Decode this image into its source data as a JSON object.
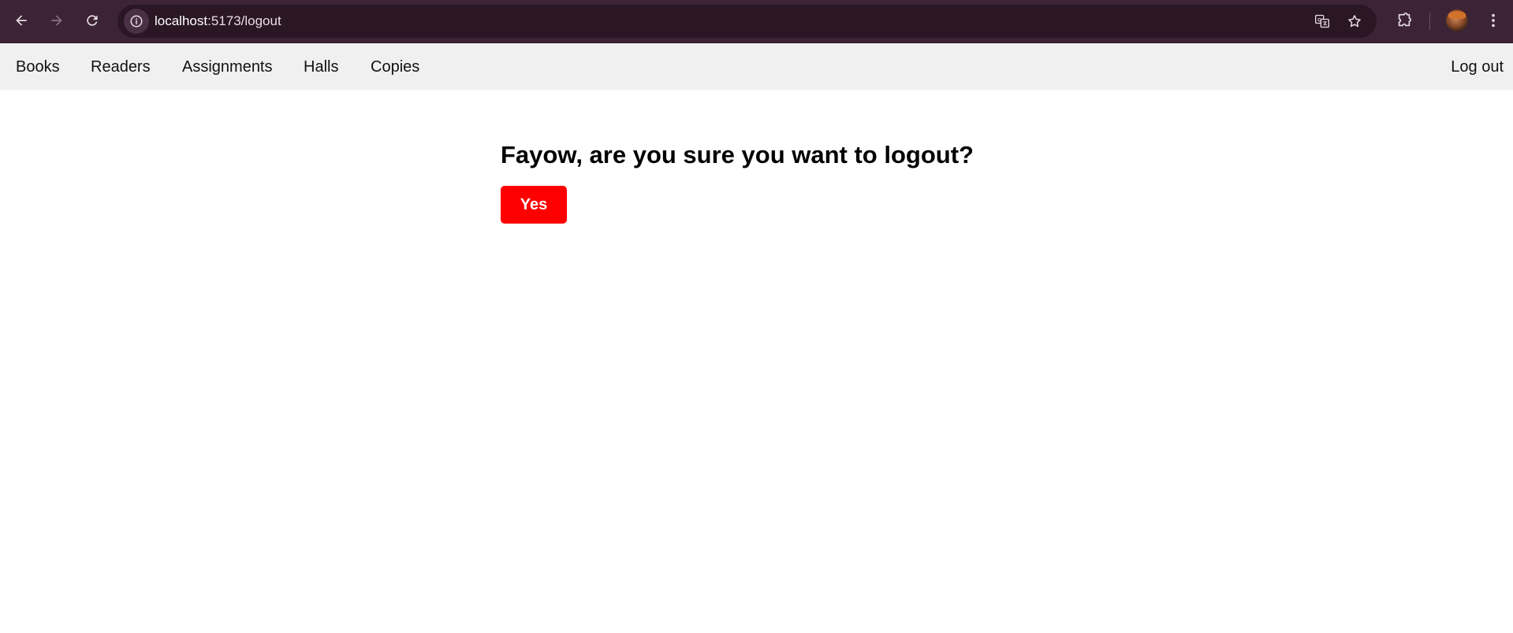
{
  "browser": {
    "url_host": "localhost",
    "url_path": ":5173/logout",
    "frame_color": "#3c2335",
    "omnibox_color": "#2a1624",
    "icons": {
      "back": "arrow-left-icon",
      "forward": "arrow-right-icon",
      "reload": "reload-icon",
      "site_info": "info-icon",
      "translate": "translate-icon",
      "bookmark": "star-icon",
      "extensions": "puzzle-icon",
      "profile": "avatar",
      "menu": "kebab-menu-icon"
    }
  },
  "nav": {
    "background": "#f0f0f0",
    "items": [
      {
        "label": "Books"
      },
      {
        "label": "Readers"
      },
      {
        "label": "Assignments"
      },
      {
        "label": "Halls"
      },
      {
        "label": "Copies"
      }
    ],
    "logout_label": "Log out"
  },
  "main": {
    "title": "Fayow, are you sure you want to logout?",
    "confirm_label": "Yes",
    "confirm_color": "#ff0000"
  }
}
